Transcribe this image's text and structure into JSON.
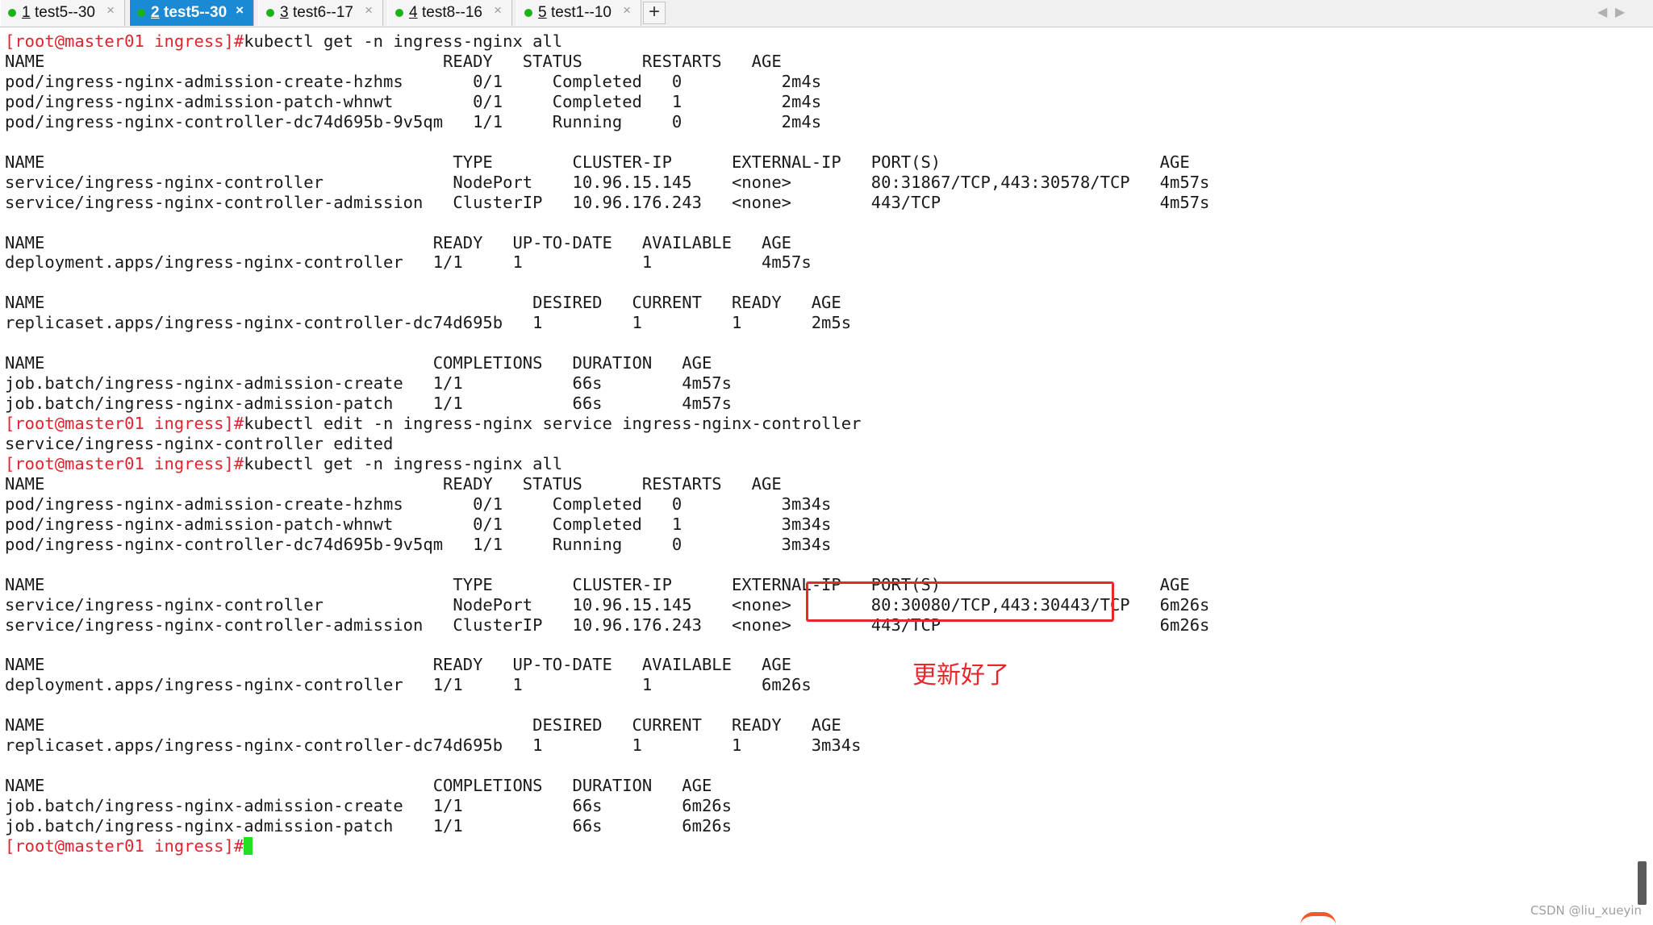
{
  "tabs": [
    {
      "num": "1",
      "label": "test5--30",
      "active": false
    },
    {
      "num": "2",
      "label": "test5--30",
      "active": true
    },
    {
      "num": "3",
      "label": "test6--17",
      "active": false
    },
    {
      "num": "4",
      "label": "test8--16",
      "active": false
    },
    {
      "num": "5",
      "label": "test1--10",
      "active": false
    }
  ],
  "tab_close_glyph": "×",
  "tab_add_glyph": "+",
  "nav": {
    "left": "◀",
    "right": "▶"
  },
  "colors": {
    "prompt": "#e0242f",
    "cursor": "#21e021",
    "annotation": "#e8262b",
    "active_tab": "#1a8ad4",
    "tab_dot": "#19b319"
  },
  "terminal": {
    "lines": [
      {
        "prompt": "[root@master01 ingress]#",
        "text": "kubectl get -n ingress-nginx all"
      },
      {
        "text": "NAME                                        READY   STATUS      RESTARTS   AGE"
      },
      {
        "text": "pod/ingress-nginx-admission-create-hzhms       0/1     Completed   0          2m4s"
      },
      {
        "text": "pod/ingress-nginx-admission-patch-whnwt        0/1     Completed   1          2m4s"
      },
      {
        "text": "pod/ingress-nginx-controller-dc74d695b-9v5qm   1/1     Running     0          2m4s"
      },
      {
        "text": ""
      },
      {
        "text": "NAME                                         TYPE        CLUSTER-IP      EXTERNAL-IP   PORT(S)                      AGE"
      },
      {
        "text": "service/ingress-nginx-controller             NodePort    10.96.15.145    <none>        80:31867/TCP,443:30578/TCP   4m57s"
      },
      {
        "text": "service/ingress-nginx-controller-admission   ClusterIP   10.96.176.243   <none>        443/TCP                      4m57s"
      },
      {
        "text": ""
      },
      {
        "text": "NAME                                       READY   UP-TO-DATE   AVAILABLE   AGE"
      },
      {
        "text": "deployment.apps/ingress-nginx-controller   1/1     1            1           4m57s"
      },
      {
        "text": ""
      },
      {
        "text": "NAME                                                 DESIRED   CURRENT   READY   AGE"
      },
      {
        "text": "replicaset.apps/ingress-nginx-controller-dc74d695b   1         1         1       2m5s"
      },
      {
        "text": ""
      },
      {
        "text": "NAME                                       COMPLETIONS   DURATION   AGE"
      },
      {
        "text": "job.batch/ingress-nginx-admission-create   1/1           66s        4m57s"
      },
      {
        "text": "job.batch/ingress-nginx-admission-patch    1/1           66s        4m57s"
      },
      {
        "prompt": "[root@master01 ingress]#",
        "text": "kubectl edit -n ingress-nginx service ingress-nginx-controller"
      },
      {
        "text": "service/ingress-nginx-controller edited"
      },
      {
        "prompt": "[root@master01 ingress]#",
        "text": "kubectl get -n ingress-nginx all"
      },
      {
        "text": "NAME                                        READY   STATUS      RESTARTS   AGE"
      },
      {
        "text": "pod/ingress-nginx-admission-create-hzhms       0/1     Completed   0          3m34s"
      },
      {
        "text": "pod/ingress-nginx-admission-patch-whnwt        0/1     Completed   1          3m34s"
      },
      {
        "text": "pod/ingress-nginx-controller-dc74d695b-9v5qm   1/1     Running     0          3m34s"
      },
      {
        "text": ""
      },
      {
        "text": "NAME                                         TYPE        CLUSTER-IP      EXTERNAL-IP   PORT(S)                      AGE"
      },
      {
        "text": "service/ingress-nginx-controller             NodePort    10.96.15.145    <none>        80:30080/TCP,443:30443/TCP   6m26s"
      },
      {
        "text": "service/ingress-nginx-controller-admission   ClusterIP   10.96.176.243   <none>        443/TCP                      6m26s"
      },
      {
        "text": ""
      },
      {
        "text": "NAME                                       READY   UP-TO-DATE   AVAILABLE   AGE"
      },
      {
        "text": "deployment.apps/ingress-nginx-controller   1/1     1            1           6m26s"
      },
      {
        "text": ""
      },
      {
        "text": "NAME                                                 DESIRED   CURRENT   READY   AGE"
      },
      {
        "text": "replicaset.apps/ingress-nginx-controller-dc74d695b   1         1         1       3m34s"
      },
      {
        "text": ""
      },
      {
        "text": "NAME                                       COMPLETIONS   DURATION   AGE"
      },
      {
        "text": "job.batch/ingress-nginx-admission-create   1/1           66s        6m26s"
      },
      {
        "text": "job.batch/ingress-nginx-admission-patch    1/1           66s        6m26s"
      },
      {
        "prompt": "[root@master01 ingress]#",
        "text": "",
        "cursor": true
      }
    ]
  },
  "annotation": {
    "text": "更新好了"
  },
  "watermark": "CSDN @liu_xueyin"
}
